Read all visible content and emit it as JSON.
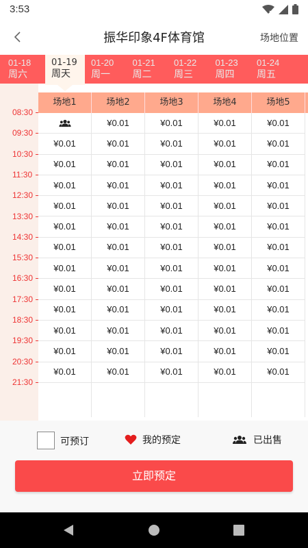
{
  "status": {
    "time": "3:53"
  },
  "header": {
    "title": "振华印象4F体育馆",
    "location_label": "场地位置"
  },
  "dates": [
    {
      "date": "01-18",
      "weekday": "周六",
      "selected": false
    },
    {
      "date": "01-19",
      "weekday": "周天",
      "selected": true
    },
    {
      "date": "01-20",
      "weekday": "周一",
      "selected": false
    },
    {
      "date": "01-21",
      "weekday": "周二",
      "selected": false
    },
    {
      "date": "01-22",
      "weekday": "周三",
      "selected": false
    },
    {
      "date": "01-23",
      "weekday": "周四",
      "selected": false
    },
    {
      "date": "01-24",
      "weekday": "周五",
      "selected": false
    }
  ],
  "times": [
    "08:30",
    "09:30",
    "10:30",
    "11:30",
    "12:30",
    "13:30",
    "14:30",
    "15:30",
    "16:30",
    "17:30",
    "18:30",
    "19:30",
    "20:30",
    "21:30"
  ],
  "courts": [
    "场地1",
    "场地2",
    "场地3",
    "场地4",
    "场地5"
  ],
  "price_label": "¥0.01",
  "slots": [
    [
      "sold",
      "avail",
      "avail",
      "avail",
      "avail"
    ],
    [
      "avail",
      "avail",
      "avail",
      "avail",
      "avail"
    ],
    [
      "avail",
      "avail",
      "avail",
      "avail",
      "avail"
    ],
    [
      "avail",
      "avail",
      "avail",
      "avail",
      "avail"
    ],
    [
      "avail",
      "avail",
      "avail",
      "avail",
      "avail"
    ],
    [
      "avail",
      "avail",
      "avail",
      "avail",
      "avail"
    ],
    [
      "avail",
      "avail",
      "avail",
      "avail",
      "avail"
    ],
    [
      "avail",
      "avail",
      "avail",
      "avail",
      "avail"
    ],
    [
      "avail",
      "avail",
      "avail",
      "avail",
      "avail"
    ],
    [
      "avail",
      "avail",
      "avail",
      "avail",
      "avail"
    ],
    [
      "avail",
      "avail",
      "avail",
      "avail",
      "avail"
    ],
    [
      "avail",
      "avail",
      "avail",
      "avail",
      "avail"
    ],
    [
      "avail",
      "avail",
      "avail",
      "avail",
      "avail"
    ]
  ],
  "legend": {
    "available": "可预订",
    "mine": "我的预定",
    "sold": "已出售"
  },
  "book_button": "立即预定",
  "colors": {
    "accent": "#fa4a4a",
    "date_bar": "#ff5c5c",
    "header_row": "#ffa98d",
    "time_text": "#ee3333"
  },
  "icons": {
    "back": "back-arrow-icon",
    "sold": "group-people-icon",
    "mine": "heart-icon"
  }
}
